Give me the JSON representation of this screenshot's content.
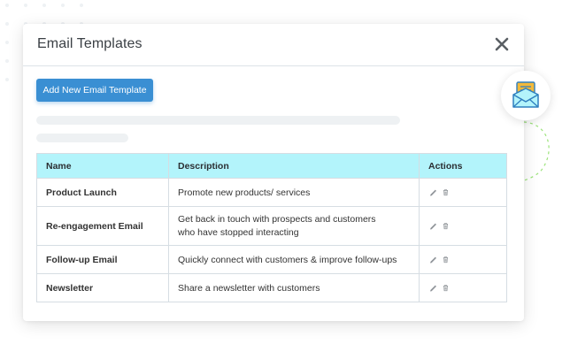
{
  "modal": {
    "title": "Email Templates",
    "add_button_label": "Add New Email Template"
  },
  "table": {
    "headers": {
      "name": "Name",
      "description": "Description",
      "actions": "Actions"
    },
    "rows": [
      {
        "name": "Product Launch",
        "description_lines": [
          "Promote new products/ services"
        ]
      },
      {
        "name": "Re-engagement Email",
        "description_lines": [
          "Get back in touch with prospects and customers",
          "who have stopped interacting"
        ]
      },
      {
        "name": "Follow-up Email",
        "description_lines": [
          "Quickly connect with customers & improve follow-ups"
        ]
      },
      {
        "name": "Newsletter",
        "description_lines": [
          "Share a newsletter with customers"
        ]
      }
    ]
  },
  "icons": {
    "close": "close-icon",
    "edit": "pencil-icon",
    "delete": "trash-icon",
    "mail_badge": "envelope-icon"
  },
  "colors": {
    "accent_button": "#3a8fd3",
    "table_header": "#b3f4fb",
    "envelope": "#f2b93b",
    "envelope_outline": "#2f7fbf",
    "decor_dashes": "#9be37a"
  }
}
